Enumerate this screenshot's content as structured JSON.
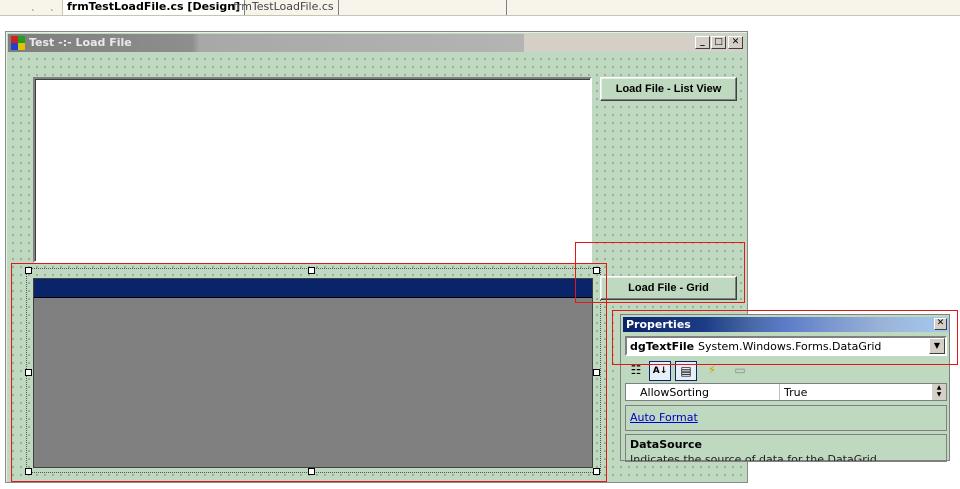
{
  "ide": {
    "tabs": [
      {
        "label": "frmTestLoadFile.cs [Design]",
        "active": true
      },
      {
        "label": "frmTestLoadFile.cs",
        "active": false
      }
    ]
  },
  "form": {
    "title": "Test -:- Load File",
    "min_glyph": "_",
    "max_glyph": "□",
    "close_glyph": "✕"
  },
  "buttons": {
    "list_view": "Load File - List View",
    "grid": "Load File - Grid"
  },
  "properties": {
    "title": "Properties",
    "close_glyph": "✕",
    "object_name": "dgTextFile",
    "object_type": "System.Windows.Forms.DataGrid",
    "toolbar": [
      {
        "name": "categorized-icon",
        "glyph": "☷"
      },
      {
        "name": "alphabetical-icon",
        "glyph": "A↓"
      },
      {
        "name": "properties-icon",
        "glyph": "▤"
      },
      {
        "name": "events-icon",
        "glyph": "⚡"
      },
      {
        "name": "property-pages-icon",
        "glyph": "▭"
      }
    ],
    "row": {
      "name": "AllowSorting",
      "value": "True"
    },
    "auto_format": "Auto Format",
    "description_title": "DataSource",
    "description_text": "Indicates the source of data for the DataGrid."
  },
  "colors": {
    "form_bg": "#bfd8c0",
    "grid_caption": "#0a246a",
    "grid_bg": "#808080",
    "annotation": "#e01818"
  }
}
